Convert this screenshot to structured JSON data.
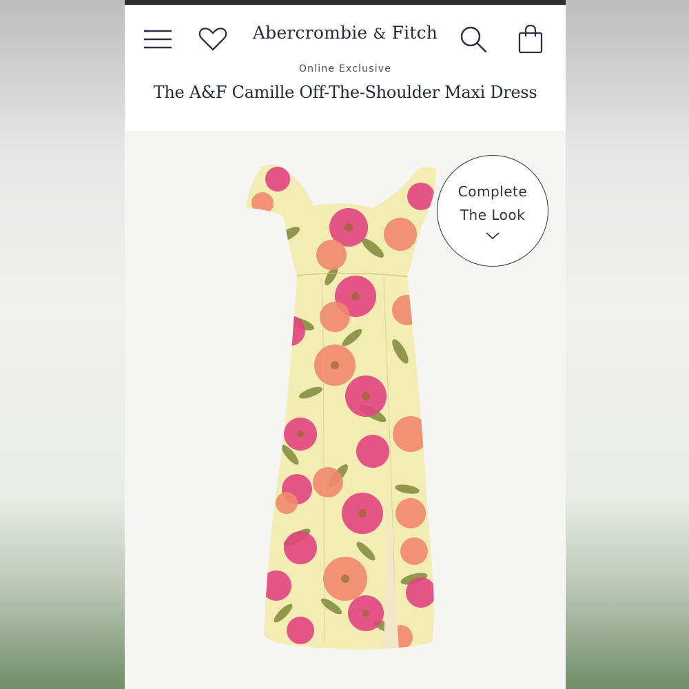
{
  "header": {
    "brand_name": "Abercrombie",
    "brand_amp": "&",
    "brand_name2": "Fitch",
    "icons": [
      "menu-icon",
      "heart-icon",
      "search-icon",
      "shopping-bag-icon"
    ]
  },
  "product": {
    "subtitle": "Online Exclusive",
    "title": "The A&F Camille Off-The-Shoulder Maxi Dress"
  },
  "complete_the_look": {
    "line1": "Complete",
    "line2": "The Look",
    "icon": "chevron-down-icon"
  },
  "colors": {
    "brand_navy": "#1f2a3a",
    "dress_base": "#f3ecb3",
    "flower_pink": "#e0457f",
    "flower_coral": "#f08a6e",
    "leaf_green": "#7d8a3b"
  }
}
